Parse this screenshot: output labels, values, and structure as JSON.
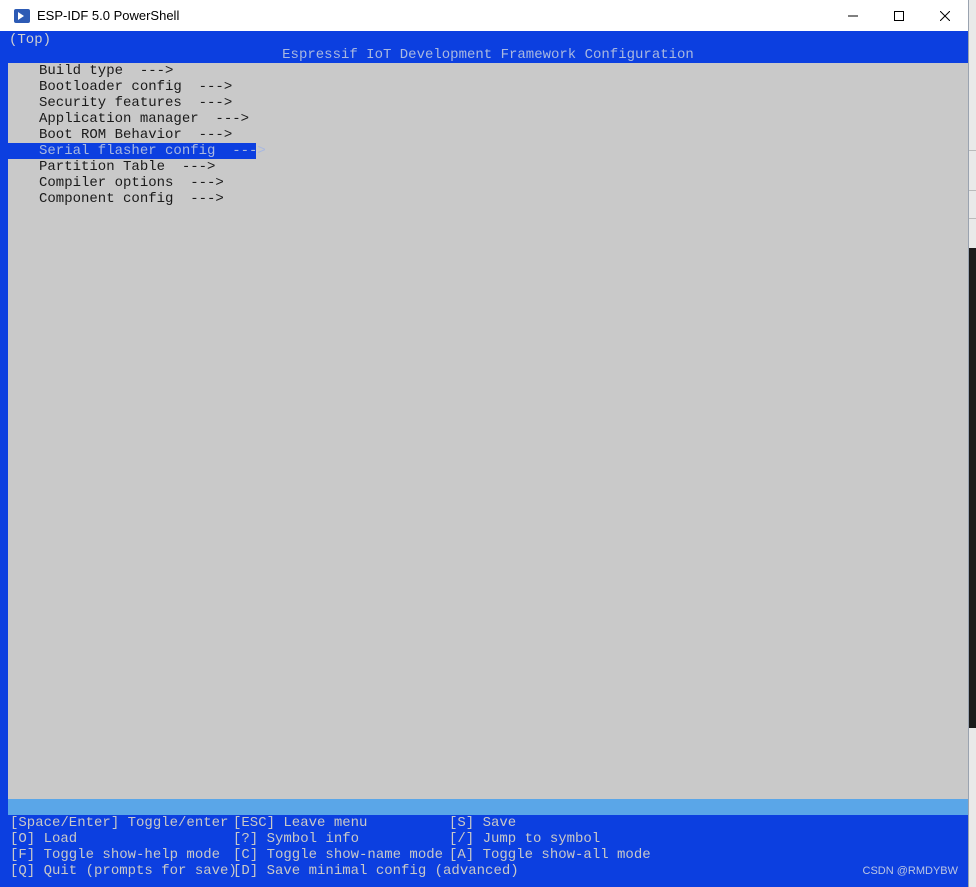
{
  "window": {
    "title": "ESP-IDF 5.0 PowerShell",
    "controls": {
      "minimize": "minimize",
      "maximize": "maximize",
      "close": "close"
    }
  },
  "breadcrumb": "(Top)",
  "header": "Espressif IoT Development Framework Configuration",
  "menu": {
    "items": [
      {
        "label": "Build type  --->",
        "selected": false
      },
      {
        "label": "Bootloader config  --->",
        "selected": false
      },
      {
        "label": "Security features  --->",
        "selected": false
      },
      {
        "label": "Application manager  --->",
        "selected": false
      },
      {
        "label": "Boot ROM Behavior  --->",
        "selected": false
      },
      {
        "label": "Serial flasher config  --->",
        "selected": true
      },
      {
        "label": "Partition Table  --->",
        "selected": false
      },
      {
        "label": "Compiler options  --->",
        "selected": false
      },
      {
        "label": "Component config  --->",
        "selected": false
      }
    ]
  },
  "help": {
    "col1": [
      "[Space/Enter] Toggle/enter",
      "[O] Load",
      "[F] Toggle show-help mode",
      "[Q] Quit (prompts for save)"
    ],
    "col2": [
      "[ESC] Leave menu",
      "[?] Symbol info",
      "[C] Toggle show-name mode",
      "[D] Save minimal config (advanced)"
    ],
    "col3": [
      "[S] Save",
      "[/] Jump to symbol",
      "[A] Toggle show-all mode",
      ""
    ]
  },
  "watermark": "CSDN @RMDYBW",
  "colors": {
    "terminal_blue": "#0c3fe0",
    "menu_gray": "#c9c9c9",
    "hint_band": "#5aa6e8"
  }
}
